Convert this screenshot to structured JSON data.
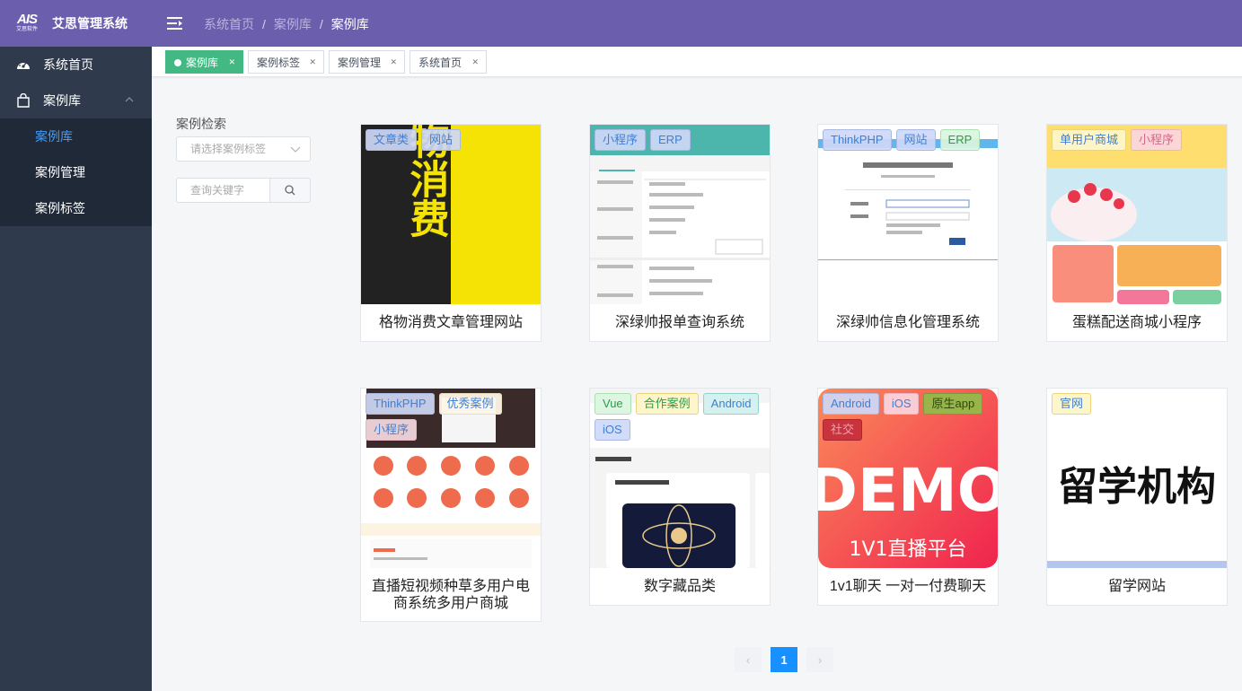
{
  "app": {
    "logo_text": "AIS",
    "logo_subtext": "艾思软件",
    "title": "艾思管理系统"
  },
  "breadcrumb": [
    "系统首页",
    "案例库",
    "案例库"
  ],
  "sidebar": {
    "items": [
      {
        "label": "系统首页",
        "icon": "dashboard-icon"
      },
      {
        "label": "案例库",
        "icon": "shopping-bag-icon",
        "expanded": true
      }
    ],
    "submenu": [
      {
        "label": "案例库",
        "active": true
      },
      {
        "label": "案例管理",
        "active": false
      },
      {
        "label": "案例标签",
        "active": false
      }
    ]
  },
  "tabs": [
    {
      "label": "案例库",
      "active": true
    },
    {
      "label": "案例标签",
      "active": false
    },
    {
      "label": "案例管理",
      "active": false
    },
    {
      "label": "系统首页",
      "active": false
    }
  ],
  "filter": {
    "title": "案例检索",
    "select_placeholder": "请选择案例标签",
    "search_placeholder": "查询关键字"
  },
  "cards": [
    {
      "title": "格物消费文章管理网站",
      "tags": [
        "文章类",
        "网站"
      ],
      "thumb_text": "格物消费"
    },
    {
      "title": "深绿帅报单查询系统",
      "tags": [
        "小程序",
        "ERP"
      ]
    },
    {
      "title": "深绿帅信息化管理系统",
      "tags": [
        "ThinkPHP",
        "网站",
        "ERP"
      ]
    },
    {
      "title": "蛋糕配送商城小程序",
      "tags": [
        "单用户商城",
        "小程序"
      ]
    },
    {
      "title": "直播短视频种草多用户电商系统多用户商城",
      "tags": [
        "ThinkPHP",
        "优秀案例",
        "小程序"
      ]
    },
    {
      "title": "数字藏品类",
      "tags": [
        "Vue",
        "合作案例",
        "Android",
        "iOS"
      ]
    },
    {
      "title": "1v1聊天 一对一付费聊天",
      "tags": [
        "Android",
        "iOS",
        "原生app",
        "社交"
      ],
      "thumb_text": "DEMO",
      "thumb_subtext": "1V1直播平台"
    },
    {
      "title": "留学网站",
      "tags": [
        "官网"
      ],
      "thumb_text": "留学机构"
    }
  ],
  "pagination": {
    "prev": "‹",
    "current": "1",
    "next": "›"
  },
  "colors": {
    "topbar": "#6b5fad",
    "sidebar": "#2f3a4c",
    "submenu": "#1f2937",
    "active_link": "#409eff",
    "active_tab": "#42b983",
    "pagination_active": "#1890ff"
  }
}
